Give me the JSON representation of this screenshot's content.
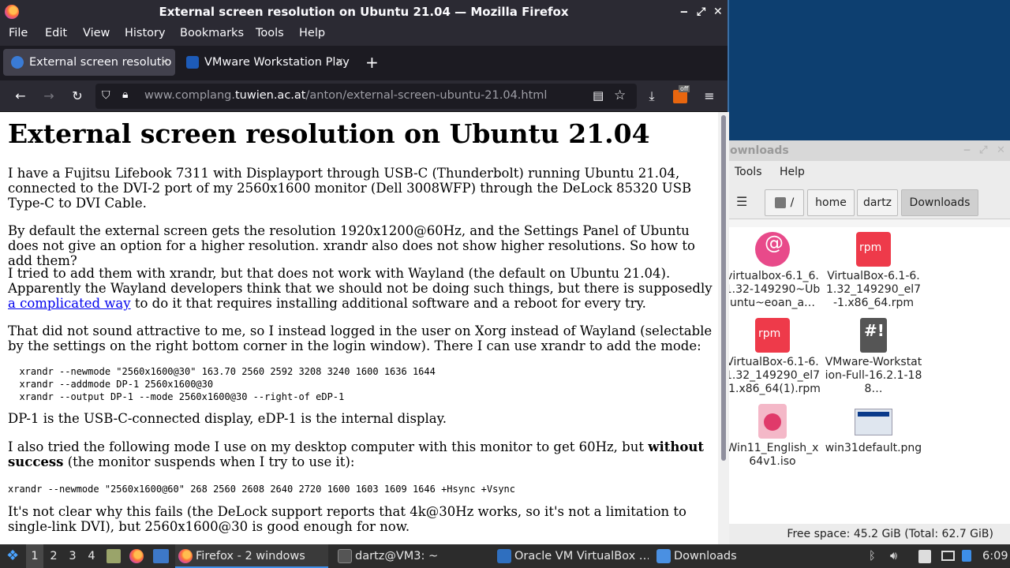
{
  "firefox": {
    "window_title": "External screen resolution on Ubuntu 21.04 — Mozilla Firefox",
    "menu": [
      "File",
      "Edit",
      "View",
      "History",
      "Bookmarks",
      "Tools",
      "Help"
    ],
    "tabs": [
      {
        "label": "External screen resolutio",
        "close": "×"
      },
      {
        "label": "VMware Workstation Play",
        "close": "×"
      }
    ],
    "new_tab": "+",
    "url_prefix": "www.complang.",
    "url_domain": "tuwien.ac.at",
    "url_path": "/anton/external-screen-ubuntu-21.04.html",
    "badge": "off"
  },
  "page": {
    "heading": "External screen resolution on Ubuntu 21.04",
    "p1": "I have a Fujitsu Lifebook 7311 with Displayport through USB-C (Thunderbolt) running Ubuntu 21.04, connected to the DVI-2 port of my 2560x1600 monitor (Dell 3008WFP) through the DeLock 85320 USB Type-C to DVI Cable.",
    "p2": "By default the external screen gets the resolution 1920x1200@60Hz, and the Settings Panel of Ubuntu does not give an option for a higher resolution. xrandr also does not show higher resolutions. So how to add them?",
    "p3_before": "I tried to add them with xrandr, but that does not work with Wayland (the default on Ubuntu 21.04). Apparently the Wayland developers think that we should not be doing such things, but there is supposedly ",
    "p3_link": "a complicated way",
    "p3_after": " to do it that requires installing additional software and a reboot for every try.",
    "p4": "That did not sound attractive to me, so I instead logged in the user on Xorg instead of Wayland (selectable by the settings on the right bottom corner in the login window). There I can use xrandr to add the mode:",
    "code1": "  xrandr --newmode \"2560x1600@30\" 163.70 2560 2592 3208 3240 1600 1636 1644\n  xrandr --addmode DP-1 2560x1600@30\n  xrandr --output DP-1 --mode 2560x1600@30 --right-of eDP-1",
    "p5": "DP-1 is the USB-C-connected display, eDP-1 is the internal display.",
    "p6_before": "I also tried the following mode I use on my desktop computer with this monitor to get 60Hz, but ",
    "p6_bold": "without success",
    "p6_after": " (the monitor suspends when I try to use it):",
    "code2": "xrandr --newmode \"2560x1600@60\" 268 2560 2608 2640 2720 1600 1603 1609 1646 +Hsync +Vsync",
    "p7": "It's not clear why this fails (the DeLock support reports that 4k@30Hz works, so it's not a limitation to single-link DVI), but 2560x1600@30 is good enough for now."
  },
  "filemanager": {
    "title": "ownloads",
    "menu": [
      "Tools",
      "Help"
    ],
    "path": [
      "/",
      "home",
      "dartz",
      "Downloads"
    ],
    "items": [
      {
        "name": "virtualbox-6.1_6.1.32-149290~Ubuntu~eoan_a…",
        "icon": "debian-package-icon"
      },
      {
        "name": "VirtualBox-6.1-6.1.32_149290_el7-1.x86_64.rpm",
        "icon": "rpm-package-icon"
      },
      {
        "name": "VirtualBox-6.1-6.1.32_149290_el7-1.x86_64(1).rpm",
        "icon": "rpm-package-icon"
      },
      {
        "name": "VMware-Workstation-Full-16.2.1-188…",
        "icon": "script-file-icon"
      },
      {
        "name": "Win11_English_x64v1.iso",
        "icon": "disc-image-icon"
      },
      {
        "name": "win31default.png",
        "icon": "image-thumbnail"
      }
    ],
    "status": "Free space: 45.2 GiB (Total: 62.7 GiB)"
  },
  "taskbar": {
    "workspaces": [
      "1",
      "2",
      "3",
      "4"
    ],
    "windows": [
      {
        "label": "Firefox - 2 windows"
      },
      {
        "label": "dartz@VM3: ~"
      },
      {
        "label": "Oracle VM VirtualBox …"
      },
      {
        "label": "Downloads"
      }
    ],
    "clock": "6:09"
  },
  "colors": {
    "accent": "#3d8ee8",
    "firefox_chrome": "#2b2a33",
    "link": "#0000ee"
  }
}
